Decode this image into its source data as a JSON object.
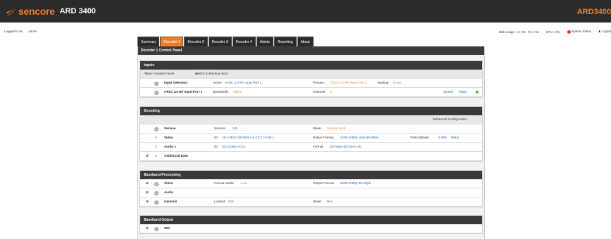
{
  "app": {
    "brand": "sencore",
    "product": "ARD 3400",
    "model_right": "ARD3400"
  },
  "user": {
    "label": "Logged in as:",
    "name": "admin"
  },
  "status": {
    "disk_label": "Disk Usage:",
    "disk_value": "1.3 GB / 90.3 GB",
    "cpu_label": "CPU:",
    "cpu_value": "46%",
    "system_status": "System Status",
    "logout": "Logout"
  },
  "tabs": [
    "Summary",
    "Decoder 1",
    "Decoder 2",
    "Decoder 3",
    "Decoder 4",
    "Admin",
    "Reporting",
    "About"
  ],
  "active_tab": 1,
  "panel_title": "Decoder 1 Control Panel",
  "inputs": {
    "title": "Inputs",
    "show_unused": "Show Unused Inputs",
    "switch_backup": "Switch to Backup Input",
    "selection": {
      "label": "Input Selection",
      "active_label": "Active:",
      "active_value": "ATSC 3.0 RF Input Port 1",
      "primary_label": "Primary:",
      "primary_value": "ATSC 3.0 RF Input Port 1",
      "backup_label": "Backup:",
      "backup_value": "None"
    },
    "port": {
      "label": "ATSC 3.0 RF Input Port 1",
      "bw_label": "Bandwidth:",
      "bw_value": "6MHz",
      "channel_label": "Channel:",
      "channel_value": "2",
      "rate": "18.628",
      "rate_unit": "Mbps"
    }
  },
  "decoding": {
    "title": "Decoding",
    "advanced": "Advanced Configuration",
    "service": {
      "label": "Service",
      "svc_label": "Service:",
      "svc_value": "146",
      "mode_label": "Mode:",
      "mode_value": "Service Lock"
    },
    "video": {
      "label": "Video",
      "id_label": "ID:",
      "id_value": "18 ( HEVC  M10@L4.1  4:2:0 10 Bit )",
      "native_label": "Native Format:",
      "native_value": "1920x1080p 16x9 59.94fps",
      "bitrate_label": "Video Bitrate:",
      "bitrate_value": "2.088",
      "bitrate_unit": "Mbps"
    },
    "audio": {
      "label": "Audio 1",
      "id_label": "ID:",
      "id_value": "20 ( Dolby AC4 )",
      "format_label": "Format:",
      "format_value": "124 kbps 48.0 kHz 2/0"
    },
    "additional": {
      "label": "Additional Data"
    }
  },
  "baseband": {
    "title": "Baseband Processing",
    "video": {
      "label": "Video",
      "fmt_label": "Format Mode:",
      "fmt_value": "Auto",
      "out_label": "Output Format:",
      "out_value": "1920x1080p 59.94fps"
    },
    "audio": {
      "label": "Audio"
    },
    "genlock": {
      "label": "Genlock",
      "locked_label": "Locked:",
      "locked_value": "N/A",
      "mode_label": "Mode:",
      "mode_value": "N/A"
    }
  },
  "output": {
    "title": "Baseband Output",
    "sdi": {
      "label": "SDI"
    }
  },
  "colors": {
    "accent": "#f07e26",
    "header": "#2b2b2b",
    "link": "#2266aa",
    "ok": "#3cbc3c",
    "alert": "#e04020"
  }
}
